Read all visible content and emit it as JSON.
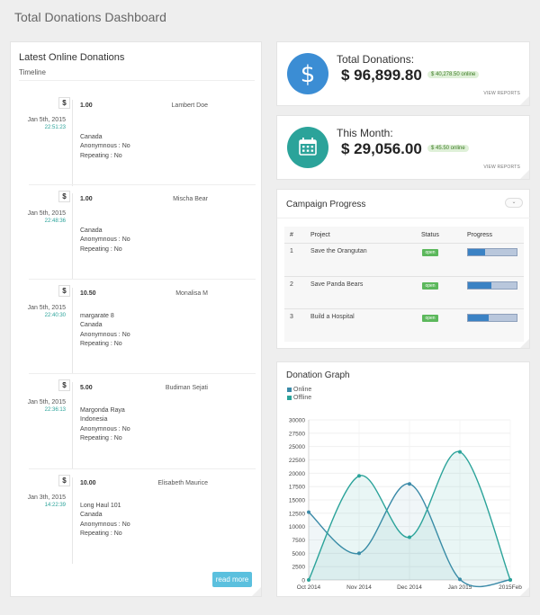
{
  "page": {
    "title": "Total Donations Dashboard"
  },
  "donations": {
    "title": "Latest Online Donations",
    "subtitle": "Timeline",
    "entries": [
      {
        "amount": "1.00",
        "name": "Lambert Doe",
        "date": "Jan 5th, 2015",
        "time": "22:51:23",
        "details": [
          "Canada",
          "Anonymnous : No",
          "Repeating : No"
        ]
      },
      {
        "amount": "1.00",
        "name": "Mischa Bear",
        "date": "Jan 5th, 2015",
        "time": "22:48:36",
        "details": [
          "Canada",
          "Anonymnous : No",
          "Repeating : No"
        ]
      },
      {
        "amount": "10.50",
        "name": "Monalisa M",
        "date": "Jan 5th, 2015",
        "time": "22:40:30",
        "details": [
          "margarate 8",
          "Canada",
          "Anonymnous : No",
          "Repeating : No"
        ]
      },
      {
        "amount": "5.00",
        "name": "Budiman Sejati",
        "date": "Jan 5th, 2015",
        "time": "22:36:13",
        "details": [
          "Margonda Raya",
          "Indonesia",
          "Anonymnous : No",
          "Repeating : No"
        ]
      },
      {
        "amount": "10.00",
        "name": "Elisabeth Maurice",
        "date": "Jan 3th, 2015",
        "time": "14:22:39",
        "details": [
          "Long Haul 101",
          "Canada",
          "Anonymnous : No",
          "Repeating : No"
        ]
      }
    ],
    "read_more": "read more"
  },
  "stats": {
    "total": {
      "label": "Total Donations:",
      "value": "$ 96,899.80",
      "badge": "$ 40,278.50 online",
      "link": "VIEW REPORTS",
      "icon": "dollar-icon"
    },
    "month": {
      "label": "This Month:",
      "value": "$ 29,056.00",
      "badge": "$ 45.50 online",
      "link": "VIEW REPORTS",
      "icon": "calendar-icon"
    }
  },
  "campaign": {
    "title": "Campaign Progress",
    "headers": {
      "num": "#",
      "project": "Project",
      "status": "Status",
      "progress": "Progress"
    },
    "rows": [
      {
        "num": "1",
        "project": "Save the Orangutan",
        "status": "open",
        "progress": 0.36
      },
      {
        "num": "2",
        "project": "Save Panda Bears",
        "status": "open",
        "progress": 0.48
      },
      {
        "num": "3",
        "project": "Build a Hospital",
        "status": "open",
        "progress": 0.42
      }
    ]
  },
  "chart_data": {
    "type": "line",
    "title": "Donation Graph",
    "x": [
      "Oct 2014",
      "Nov 2014",
      "Dec 2014",
      "Jan 2015",
      "2015Feb"
    ],
    "series": [
      {
        "name": "Online",
        "values": [
          12700,
          5000,
          18000,
          100,
          0
        ],
        "color": "#3b8aa8"
      },
      {
        "name": "Offline",
        "values": [
          0,
          19500,
          8000,
          24000,
          0
        ],
        "color": "#2ba39a"
      }
    ],
    "yticks": [
      0,
      2500,
      5000,
      7500,
      10000,
      12500,
      15000,
      17500,
      20000,
      22500,
      25000,
      27500,
      30000
    ],
    "ylim": [
      0,
      30000
    ],
    "legend": "top-left",
    "grid": true
  }
}
